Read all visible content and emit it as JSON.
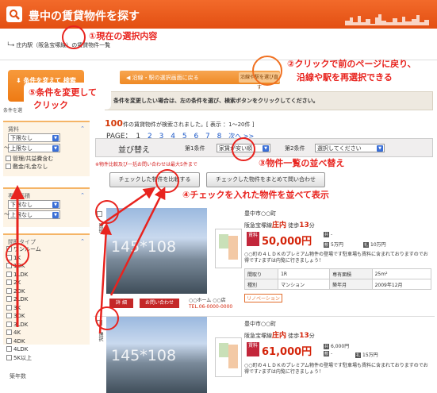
{
  "header": {
    "title": "豊中の賃貸物件を探す"
  },
  "breadcrumb": {
    "text": "庄内駅（阪急宝塚線）の賃貸物件一覧"
  },
  "annotations": {
    "n1": "①現在の選択内容",
    "n2a": "②クリックで前のページに戻り、",
    "n2b": "沿線や駅を再選択できる",
    "n3": "③物件一覧の並べ替え",
    "n4": "④チェックを入れた物件を並べて表示",
    "n5a": "⑤条件を変更して",
    "n5b": "クリック"
  },
  "sidebar": {
    "search_button": "条件を変えて 検索",
    "condition_heading": "条件を選",
    "rent_panel": {
      "title": "賃料",
      "min": "下限なし",
      "max": "上限なし",
      "options": [
        "管理/共益費含む",
        "敷金/礼金なし"
      ]
    },
    "area_panel": {
      "title": "専有面積",
      "min": "下限なし",
      "max": "上限なし"
    },
    "layout_panel": {
      "title": "間取タイプ",
      "options": [
        "ワンルーム",
        "1K",
        "1DK",
        "1LDK",
        "2K",
        "2DK",
        "2LDK",
        "3K",
        "3DK",
        "3LDK",
        "4K",
        "4DK",
        "4LDK",
        "5K以上"
      ]
    },
    "age_heading": "築年数"
  },
  "main": {
    "back_button": "沿線・駅の選択画面に戻る",
    "back_button_tail": "沿線や駅を選び直す",
    "info_text": "条件を変更したい場合は、左の条件を選び、検索ボタンをクリックしてください。",
    "count_num": "100",
    "count_text": "件の賃貸物件が検索されました。[ 表示 ：1〜20件 ]",
    "page_label": "PAGE：",
    "pages": [
      "1",
      "2",
      "3",
      "4",
      "5",
      "6",
      "7",
      "8",
      "次へ >>"
    ],
    "sort_label": "並び替え",
    "sort1_label": "第1条件",
    "sort1_value": "家賃が安い順",
    "sort2_label": "第2条件",
    "sort2_value": "選択してください",
    "warning": "※物件比較及び一括お問い合わせは最大5件まで",
    "compare_button": "チェックした物件を比較する",
    "inquire_all_button": "チェックした物件をまとめて問い合わせ"
  },
  "listings": [
    {
      "address": "豊中市○○町",
      "line": "阪急宝塚線",
      "station": "庄内",
      "walk_pre": "徒歩",
      "walk": "13",
      "walk_unit": "分",
      "rent_tag": "賃料",
      "price": "50,000円",
      "fee_label": "共",
      "fee": "-",
      "deposit_label": "敷",
      "deposit": "5万円",
      "key_label": "礼",
      "key_money": "10万円",
      "watermark": "145*108",
      "description": "○○町の４ＬＤＫのプレミアム物件の登場です駐車場も賃料に含まれておりますのでお得です♪まずは内覧に行きましょう！",
      "table": {
        "layout_h": "間取り",
        "layout": "1R",
        "area_h": "専有面積",
        "area": "25m²",
        "type_h": "種別",
        "type": "マンション",
        "built_h": "築年月",
        "built": "2009年12月"
      },
      "badge": "リノベーション",
      "detail_button": "詳 細",
      "inquire_button": "お問い合わせ",
      "agent_name": "○○ホーム ○○店",
      "agent_tel": "TEL.06-0000-0000",
      "check_label": "選択"
    },
    {
      "address": "豊中市○○町",
      "line": "阪急宝塚線",
      "station": "庄内",
      "walk_pre": "徒歩",
      "walk": "13",
      "walk_unit": "分",
      "rent_tag": "賃料",
      "price": "61,000円",
      "fee_label": "共",
      "fee": "6,000円",
      "deposit_label": "敷",
      "deposit": "-",
      "key_label": "礼",
      "key_money": "15万円",
      "watermark": "145*108",
      "description": "○○町の４ＬＤＫのプレミアム物件の登場です駐車場も賃料に含まれておりますのでお得です♪まずは内覧に行きましょう！",
      "check_label": "選択"
    }
  ]
}
